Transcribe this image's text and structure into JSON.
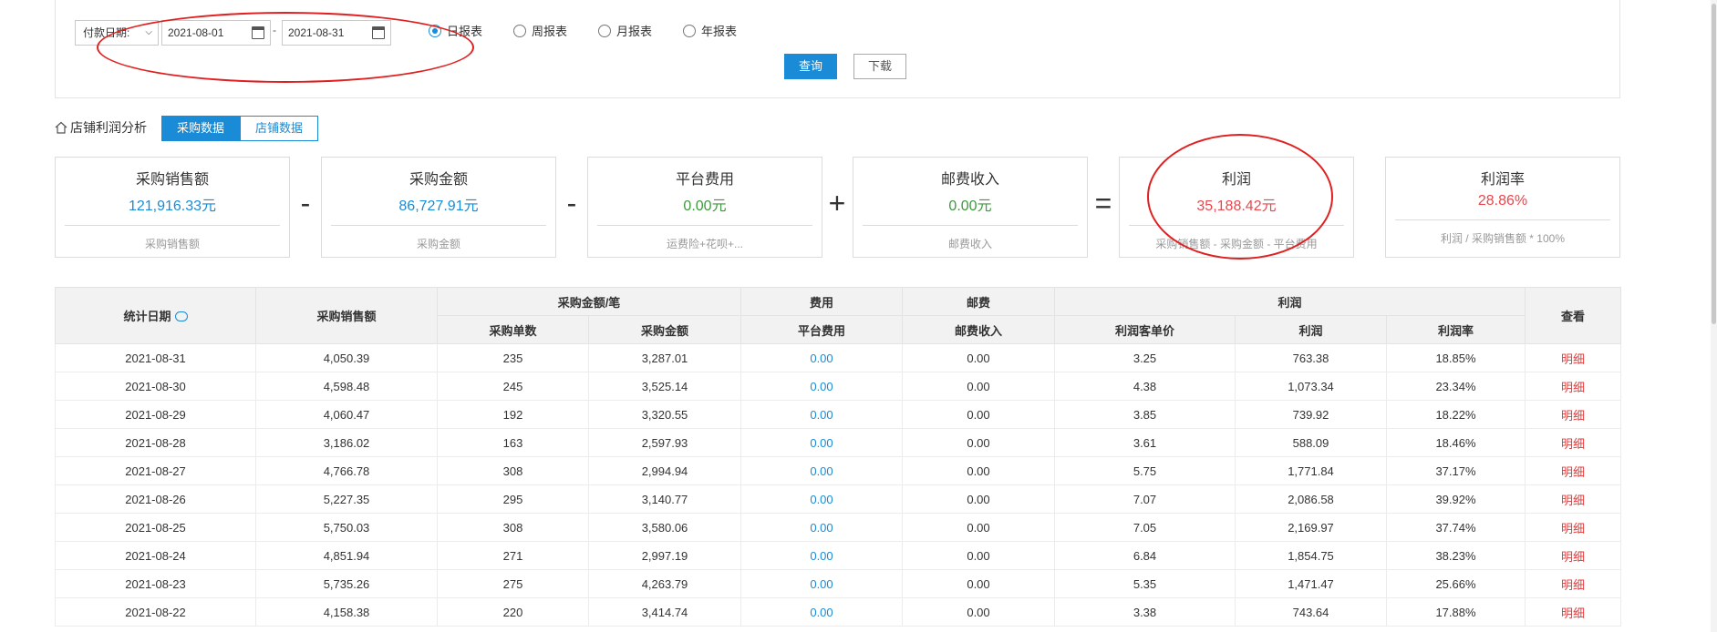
{
  "filters": {
    "date_type_label": "付款日期:",
    "start_date": "2021-08-01",
    "end_date": "2021-08-31",
    "date_separator": "-",
    "report_options": [
      {
        "label": "日报表",
        "checked": true
      },
      {
        "label": "周报表",
        "checked": false
      },
      {
        "label": "月报表",
        "checked": false
      },
      {
        "label": "年报表",
        "checked": false
      }
    ],
    "query_label": "查询",
    "download_label": "下载"
  },
  "section": {
    "title": "店铺利润分析",
    "tab_purchase": "采购数据",
    "tab_shop": "店铺数据"
  },
  "cards": [
    {
      "title": "采购销售额",
      "value": "121,916.33元",
      "desc": "采购销售额",
      "color": "#1a8bd6"
    },
    {
      "title": "采购金额",
      "value": "86,727.91元",
      "desc": "采购金额",
      "color": "#1a8bd6"
    },
    {
      "title": "平台费用",
      "value": "0.00元",
      "desc": "运费险+花呗+...",
      "color": "#3c9a3c"
    },
    {
      "title": "邮费收入",
      "value": "0.00元",
      "desc": "邮费收入",
      "color": "#3c9a3c"
    },
    {
      "title": "利润",
      "value": "35,188.42元",
      "desc": "采购销售额 - 采购金额 - 平台费用",
      "color": "#e8474c"
    },
    {
      "title": "利润率",
      "value": "28.86%",
      "desc": "利润 / 采购销售额 * 100%",
      "color": "#e8474c"
    }
  ],
  "operators": [
    "-",
    "-",
    "+",
    "="
  ],
  "table": {
    "group_headers": {
      "date": "统计日期",
      "sales": "采购销售额",
      "purchase_group": "采购金额/笔",
      "fee_group": "费用",
      "postage_group": "邮费",
      "profit_group": "利润",
      "view": "查看"
    },
    "sub_headers": {
      "order_count": "采购单数",
      "purchase_amount": "采购金额",
      "platform_fee": "平台费用",
      "postage_income": "邮费收入",
      "profit_per_order": "利润客单价",
      "profit": "利润",
      "profit_rate": "利润率"
    },
    "rows": [
      [
        "2021-08-31",
        "4,050.39",
        "235",
        "3,287.01",
        "0.00",
        "0.00",
        "3.25",
        "763.38",
        "18.85%",
        "明细"
      ],
      [
        "2021-08-30",
        "4,598.48",
        "245",
        "3,525.14",
        "0.00",
        "0.00",
        "4.38",
        "1,073.34",
        "23.34%",
        "明细"
      ],
      [
        "2021-08-29",
        "4,060.47",
        "192",
        "3,320.55",
        "0.00",
        "0.00",
        "3.85",
        "739.92",
        "18.22%",
        "明细"
      ],
      [
        "2021-08-28",
        "3,186.02",
        "163",
        "2,597.93",
        "0.00",
        "0.00",
        "3.61",
        "588.09",
        "18.46%",
        "明细"
      ],
      [
        "2021-08-27",
        "4,766.78",
        "308",
        "2,994.94",
        "0.00",
        "0.00",
        "5.75",
        "1,771.84",
        "37.17%",
        "明细"
      ],
      [
        "2021-08-26",
        "5,227.35",
        "295",
        "3,140.77",
        "0.00",
        "0.00",
        "7.07",
        "2,086.58",
        "39.92%",
        "明细"
      ],
      [
        "2021-08-25",
        "5,750.03",
        "308",
        "3,580.06",
        "0.00",
        "0.00",
        "7.05",
        "2,169.97",
        "37.74%",
        "明细"
      ],
      [
        "2021-08-24",
        "4,851.94",
        "271",
        "2,997.19",
        "0.00",
        "0.00",
        "6.84",
        "1,854.75",
        "38.23%",
        "明细"
      ],
      [
        "2021-08-23",
        "5,735.26",
        "275",
        "4,263.79",
        "0.00",
        "0.00",
        "5.35",
        "1,471.47",
        "25.66%",
        "明细"
      ],
      [
        "2021-08-22",
        "4,158.38",
        "220",
        "3,414.74",
        "0.00",
        "0.00",
        "3.38",
        "743.64",
        "17.88%",
        "明细"
      ]
    ]
  },
  "colors": {
    "accent": "#1a8bd6",
    "annotation": "#e02020"
  }
}
